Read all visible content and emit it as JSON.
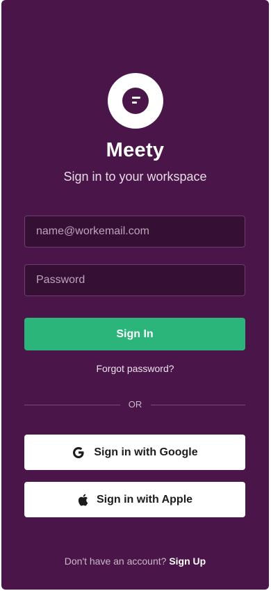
{
  "app": {
    "name": "Meety",
    "subtitle": "Sign in to your workspace"
  },
  "form": {
    "email_placeholder": "name@workemail.com",
    "email_value": "",
    "password_placeholder": "Password",
    "password_value": "",
    "sign_in_label": "Sign In",
    "forgot_password_label": "Forgot password?"
  },
  "divider": {
    "label": "OR"
  },
  "social": {
    "google_label": "Sign in with Google",
    "google_icon": "google-g-icon",
    "apple_label": "Sign in with Apple",
    "apple_icon": "apple-icon"
  },
  "footer": {
    "prompt": "Don't have an account?",
    "signup_label": "Sign Up"
  },
  "colors": {
    "background": "#4a1548",
    "primary_button": "#2bb57a",
    "input_background": "#350f34"
  }
}
